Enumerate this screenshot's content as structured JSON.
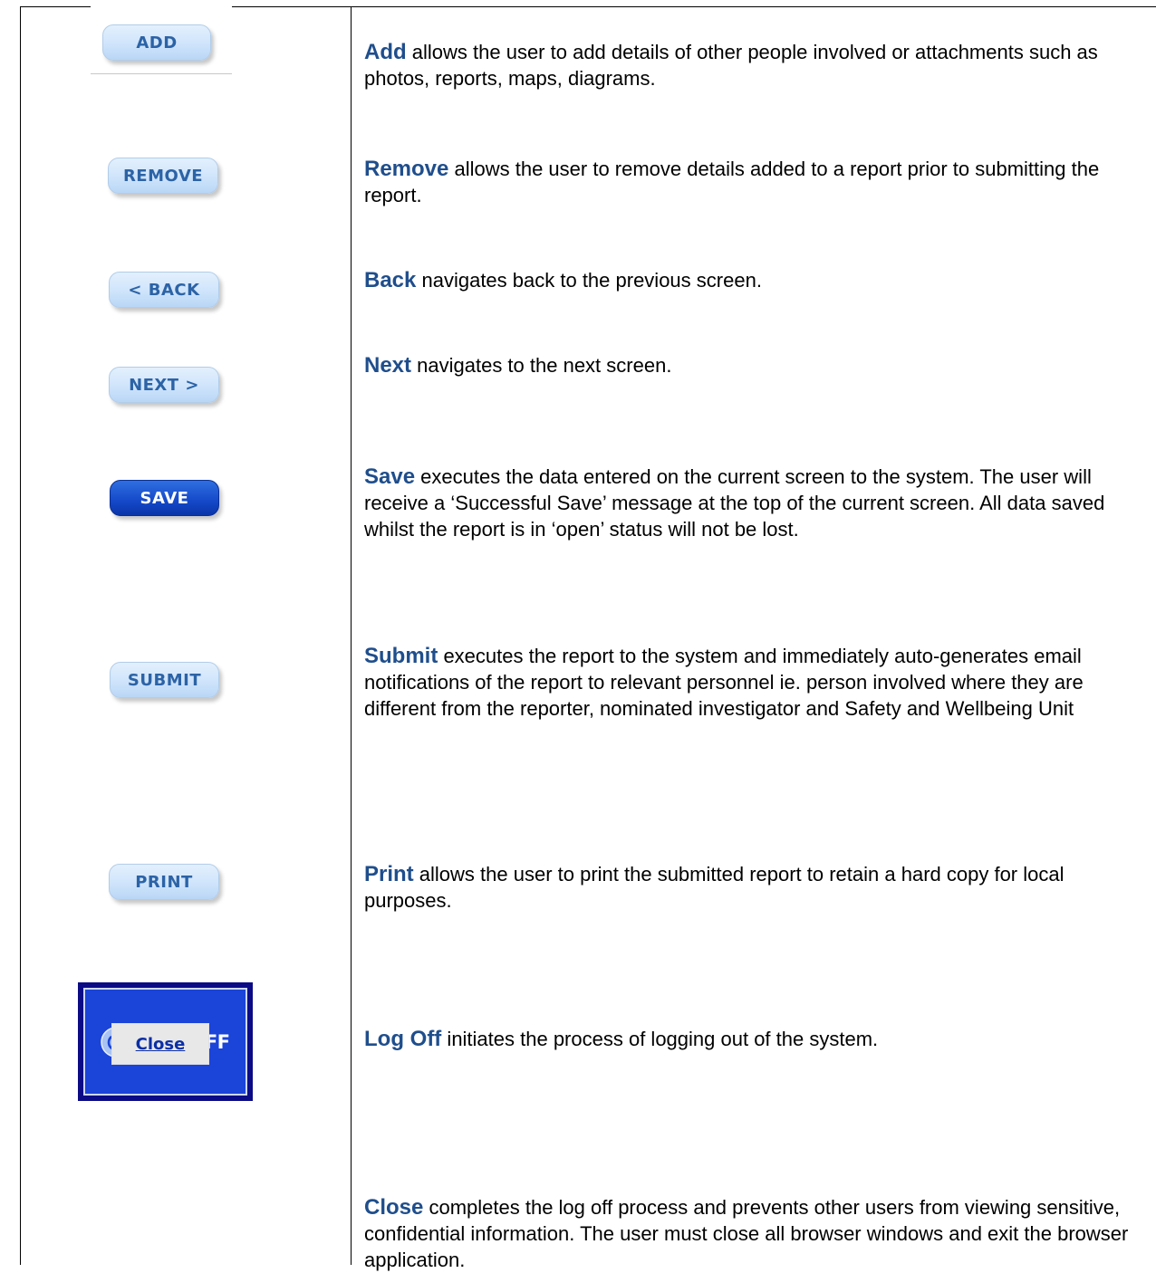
{
  "buttons": {
    "add": "ADD",
    "remove": "REMOVE",
    "back": "< BACK",
    "next": "NEXT >",
    "save": "SAVE",
    "submit": "SUBMIT",
    "print": "PRINT",
    "logoff": "LOG OFF",
    "close": "Close"
  },
  "icons": {
    "logoff_icon": "power-icon"
  },
  "colors": {
    "term_text": "#1f4e8c",
    "button_light": "#cfe4fb",
    "button_dark": "#1448c8",
    "logoff_background": "#1b44d8",
    "close_link": "#0b2fa6"
  },
  "rows": [
    {
      "term": "Add",
      "text": " allows the user to add details of other people involved or attachments such as photos, reports, maps, diagrams."
    },
    {
      "term": "Remove",
      "text": " allows the user to remove details added to a report prior to submitting the report."
    },
    {
      "term": "Back",
      "text": " navigates back to the previous screen."
    },
    {
      "term": "Next",
      "text": " navigates to the next screen."
    },
    {
      "term": "Save",
      "text": " executes the data entered on the current screen to the system. The user will receive a ‘Successful Save’ message at the top of the current screen.  All data saved whilst the report is in ‘open’ status will not be lost."
    },
    {
      "term": "Submit",
      "text": " executes the report to the system and immediately auto-generates email notifications of the report to relevant personnel ie. person involved where they are different from the reporter, nominated investigator and Safety and Wellbeing Unit"
    },
    {
      "term": "Print",
      "text": " allows the user to print the submitted report to retain a hard copy for local purposes."
    },
    {
      "term": "Log Off",
      "text": " initiates the process of logging out of the system."
    },
    {
      "term": "Close",
      "text": " completes the log off process and prevents other users from viewing sensitive, confidential information. The user must close all browser windows and exit the browser application."
    }
  ]
}
